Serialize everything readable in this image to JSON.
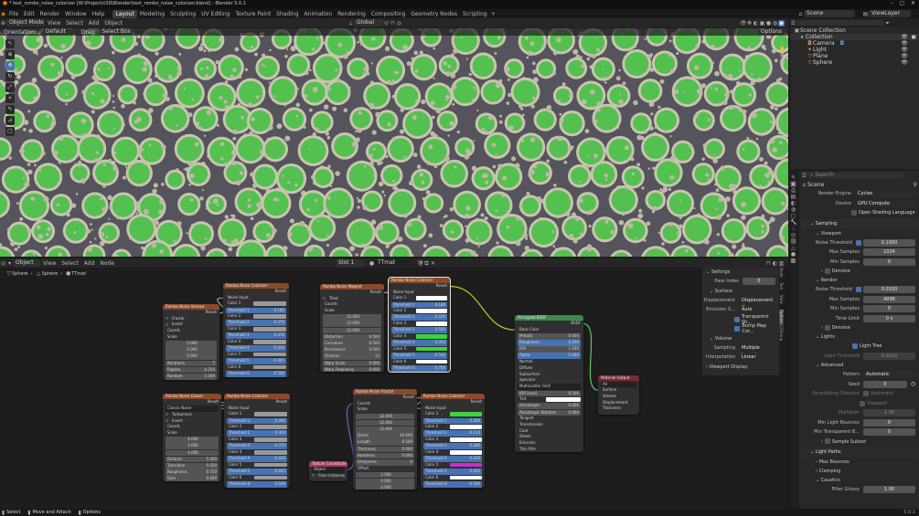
{
  "window": {
    "title": "* text_rombo_noise_colorizer [W:\\Projects\\3D\\Blender\\text_rombo_noise_colorizer.blend] - Blender 5.0.1"
  },
  "menu": [
    "File",
    "Edit",
    "Render",
    "Window",
    "Help"
  ],
  "workspaces": [
    "Layout",
    "Modeling",
    "Sculpting",
    "UV Editing",
    "Texture Paint",
    "Shading",
    "Animation",
    "Rendering",
    "Compositing",
    "Geometry Nodes",
    "Scripting"
  ],
  "top_right": {
    "scene_label": "Scene",
    "view_layer_label": "ViewLayer"
  },
  "viewport_header": {
    "mode": "Object Mode",
    "view": "View",
    "select": "Select",
    "add": "Add",
    "object": "Object",
    "orientation_space": "Global"
  },
  "viewport_sub": {
    "orientation_label": "Orientation:",
    "orientation_value": "Default",
    "drag_label": "Drag:",
    "drag_value": "Select Box",
    "options": "Options"
  },
  "outliner": {
    "title": "Scene Collection",
    "items": [
      {
        "name": "Collection",
        "depth": 1
      },
      {
        "name": "Camera",
        "depth": 2
      },
      {
        "name": "Light",
        "depth": 2
      },
      {
        "name": "Plane",
        "depth": 2
      },
      {
        "name": "Sphere",
        "depth": 2
      }
    ]
  },
  "node_header": {
    "mode": "Object",
    "view": "View",
    "select": "Select",
    "add": "Add",
    "node": "Node",
    "slot": "Slot 1",
    "material": "TTmat"
  },
  "breadcrumb": [
    "Sphere",
    "Sphere",
    "TTmat"
  ],
  "side_tabs": [
    "Node",
    "Tool",
    "View",
    "Options",
    "Group"
  ],
  "nodes": {
    "sv1": {
      "title": "Rombo Noise Voronoi",
      "out": "Result",
      "rows": [
        "Fractal",
        "Invert",
        "Coords",
        "Scale",
        "0.000",
        "0.000",
        "0.000",
        "Iterations",
        "Ripples",
        "Random"
      ],
      "vals": [
        "",
        "",
        "",
        "",
        "",
        "",
        "",
        "7",
        "0.250",
        "1.000"
      ]
    },
    "sc1": {
      "title": "Rombo Noise Colorizer",
      "out": "Result",
      "rows": [
        "Noise Input",
        "Color 1",
        "Threshold 1",
        "Color 2",
        "Threshold 2",
        "Color 3",
        "Threshold 3",
        "Color 4",
        "Threshold 4",
        "Color 5",
        "Threshold 5",
        "Color 6",
        "Threshold 6"
      ],
      "vals": [
        "",
        "",
        "0.180",
        "",
        "0.275",
        "",
        "0.370",
        "",
        "0.420",
        "",
        "0.445",
        "",
        "0.540"
      ]
    },
    "mag": {
      "title": "Rombo Noise Magnet",
      "out": "Result",
      "rows": [
        "Tiled",
        "Coords",
        "Scale",
        "12.000",
        "12.000",
        "12.000",
        "Distortion",
        "Curvature",
        "Persistence",
        "Octaves",
        "Warp Scale",
        "Warp Frequency"
      ],
      "vals": [
        "",
        "",
        "",
        "",
        "",
        "",
        "0.500",
        "0.500",
        "0.500",
        "13",
        "0.000",
        "0.000"
      ]
    },
    "sc2": {
      "title": "Rombo Noise Colorizer",
      "out": "Result",
      "rows": [
        "Noise Input",
        "Color 1",
        "Threshold 1",
        "Color 2",
        "Threshold 2",
        "Color 3",
        "Threshold 3",
        "Color 4",
        "Threshold 4",
        "Color 5",
        "Threshold 5",
        "Color 6",
        "Threshold 6"
      ],
      "vals": [
        "",
        "",
        "0.180",
        "",
        "0.220",
        "",
        "0.500",
        "",
        "0.350",
        "",
        "0.540",
        "",
        "0.700"
      ]
    },
    "bsdf": {
      "title": "Principled BSDF",
      "out": "BSDF",
      "rows": [
        "Base Color",
        "Metallic",
        "Roughness",
        "IOR",
        "Alpha",
        "Normal",
        "Diffuse",
        "Subsurface",
        "Specular",
        "Multiscatter GGX",
        "IOR Level",
        "Tint",
        "Anisotropic",
        "Anisotropic Rotation",
        "Tangent",
        "Transmission",
        "Coat",
        "Sheen",
        "Emission",
        "Thin Film"
      ],
      "vals": [
        "",
        "0.000",
        "0.500",
        "1.500",
        "1.000",
        "",
        "",
        "",
        "",
        "",
        "0.500",
        "",
        "0.000",
        "0.000",
        "",
        "",
        "",
        "",
        "",
        ""
      ]
    },
    "mout": {
      "title": "Material Output",
      "rows": [
        "All",
        "Surface",
        "Volume",
        "Displacement",
        "Thickness"
      ]
    },
    "cl": {
      "title": "Rombo Noise Classic",
      "out": "Result",
      "rows": [
        "Classic Noise",
        "Turbulence",
        "Invert",
        "Coords",
        "Scale",
        "4.000",
        "4.000",
        "4.000",
        "Octaves",
        "Transition",
        "Roughness",
        "Gain"
      ],
      "vals": [
        "",
        "",
        "",
        "",
        "",
        "",
        "",
        "",
        "5.000",
        "0.050",
        "0.750",
        "0.000"
      ]
    },
    "sc3": {
      "title": "Rombo Noise Colorizer",
      "out": "Result",
      "rows": [
        "Noise Input",
        "Color 1",
        "Threshold 1",
        "Color 2",
        "Threshold 2",
        "Color 3",
        "Threshold 3",
        "Color 4",
        "Threshold 4",
        "Color 5",
        "Threshold 5",
        "Color 6",
        "Threshold 6"
      ],
      "vals": [
        "",
        "",
        "0.280",
        "",
        "0.300",
        "",
        "0.375",
        "",
        "0.420",
        "",
        "0.445",
        "",
        "0.540"
      ]
    },
    "tc": {
      "title": "Texture Coordinate",
      "rows": [
        "Object",
        "From Instancer"
      ]
    },
    "frac": {
      "title": "Rombo Noise Fractal",
      "out": "Result",
      "rows": [
        "Coords",
        "Scale",
        "12.000",
        "12.000",
        "12.000",
        "Detail",
        "Length",
        "Thickness",
        "Hardness",
        "Sharpness",
        "Offset",
        "2.500",
        "0.000",
        "0.000"
      ],
      "vals": [
        "",
        "",
        "",
        "",
        "",
        "10.000",
        "0.500",
        "0.000",
        "0.000",
        "0",
        "",
        "",
        "",
        ""
      ]
    },
    "sc4": {
      "title": "Rombo Noise Colorizer",
      "out": "Result",
      "rows": [
        "Noise Input",
        "Color 1",
        "Threshold 1",
        "Color 2",
        "Threshold 2",
        "Color 3",
        "Threshold 3",
        "Color 4",
        "Threshold 4",
        "Color 5",
        "Threshold 5",
        "Color 6",
        "Threshold 6"
      ],
      "vals": [
        "",
        "",
        "0.200",
        "",
        "0.210",
        "",
        "0.280",
        "",
        "0.420",
        "",
        "0.445",
        "",
        "0.500"
      ]
    }
  },
  "n_panel": {
    "settings": "Settings",
    "pass_index_label": "Pass Index",
    "pass_index_value": "0",
    "surface": "Surface",
    "displacement_label": "Displacement",
    "displacement_value": "Displacement O...",
    "emission_label": "Emission S...",
    "emission_value": "Auto",
    "transparent_shadows": "Transparent Sh...",
    "bump_map": "Bump Map Cor...",
    "volume": "Volume",
    "sampling_label": "Sampling",
    "sampling_value": "Multiple Import...",
    "interp_label": "Interpolation",
    "interp_value": "Linear",
    "viewport_display": "Viewport Display"
  },
  "props": {
    "search_placeholder": "Search",
    "context": "Scene",
    "render_engine_label": "Render Engine",
    "render_engine_value": "Cycles",
    "device_label": "Device",
    "device_value": "GPU Compute",
    "osl": "Open Shading Language",
    "sampling": "Sampling",
    "viewport": "Viewport",
    "v_noise_label": "Noise Threshold",
    "v_noise_value": "0.1000",
    "v_max_label": "Max Samples",
    "v_max_value": "1024",
    "v_min_label": "Min Samples",
    "v_min_value": "0",
    "denoise": "Denoise",
    "render": "Render",
    "r_noise_label": "Noise Threshold",
    "r_noise_value": "0.0100",
    "r_max_label": "Max Samples",
    "r_max_value": "4096",
    "r_min_label": "Min Samples",
    "r_min_value": "0",
    "r_time_label": "Time Limit",
    "r_time_value": "0 s",
    "denoise2": "Denoise",
    "lights": "Lights",
    "light_tree": "Light Tree",
    "light_threshold_label": "Light Threshold",
    "light_threshold_value": "0.0100",
    "advanced": "Advanced",
    "pattern_label": "Pattern",
    "pattern_value": "Automatic",
    "seed_label": "Seed",
    "seed_value": "0",
    "scrambling_label": "Scrambling Distance",
    "scrambling_auto": "Automatic",
    "viewport_cb": "Viewport",
    "multiplier_label": "Multiplier",
    "multiplier_value": "1.00",
    "min_light_label": "Min Light Bounces",
    "min_light_value": "0",
    "min_trans_label": "Min Transparent B...",
    "min_trans_value": "0",
    "sample_subset": "Sample Subset",
    "light_paths": "Light Paths",
    "max_bounces": "Max Bounces",
    "clamping": "Clamping",
    "caustics": "Caustics",
    "filter_glossy_label": "Filter Glossy",
    "filter_glossy_value": "1.00"
  },
  "status": {
    "select": "Select",
    "move": "Move and Attach",
    "options": "Options",
    "version": "5.0.1"
  },
  "colors": {
    "accent": "#4772b3",
    "green": "#3fd13f",
    "magenta": "#c72fd0",
    "shader": "#3b8a4a",
    "header_output": "#7a2a30"
  }
}
